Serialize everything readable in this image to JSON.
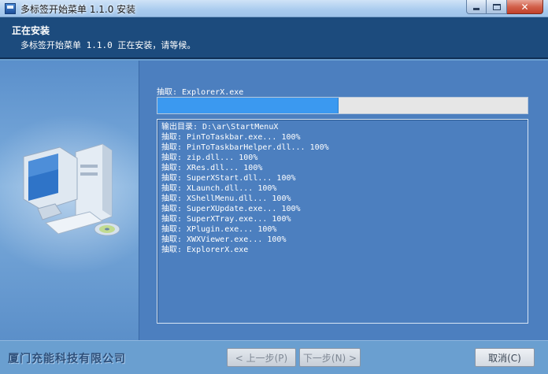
{
  "window": {
    "title": "多标签开始菜单 1.1.0 安装"
  },
  "header": {
    "title": "正在安装",
    "subtitle": "多标签开始菜单 1.1.0 正在安装，请等候。"
  },
  "progress": {
    "current_file_label": "抽取: ExplorerX.exe",
    "fraction": 0.49
  },
  "log": {
    "lines": [
      "输出目录: D:\\ar\\StartMenuX",
      "抽取: PinToTaskbar.exe... 100%",
      "抽取: PinToTaskbarHelper.dll... 100%",
      "抽取: zip.dll... 100%",
      "抽取: XRes.dll... 100%",
      "抽取: SuperXStart.dll... 100%",
      "抽取: XLaunch.dll... 100%",
      "抽取: XShellMenu.dll... 100%",
      "抽取: SuperXUpdate.exe... 100%",
      "抽取: SuperXTray.exe... 100%",
      "抽取: XPlugin.exe... 100%",
      "抽取: XWXViewer.exe... 100%",
      "抽取: ExplorerX.exe"
    ]
  },
  "footer": {
    "brand": "厦门充能科技有限公司",
    "back_label": "< 上一步(P)",
    "next_label": "下一步(N) >",
    "cancel_label": "取消(C)"
  },
  "icons": {
    "app": "installer-icon",
    "minimize": "minimize-icon",
    "maximize": "maximize-icon",
    "close": "close-icon",
    "illustration": "computer-illustration-icon"
  },
  "colors": {
    "header_bg": "#1c4b7d",
    "panel_bg": "#4c7fbf",
    "progress_fill": "#3b99f0"
  }
}
